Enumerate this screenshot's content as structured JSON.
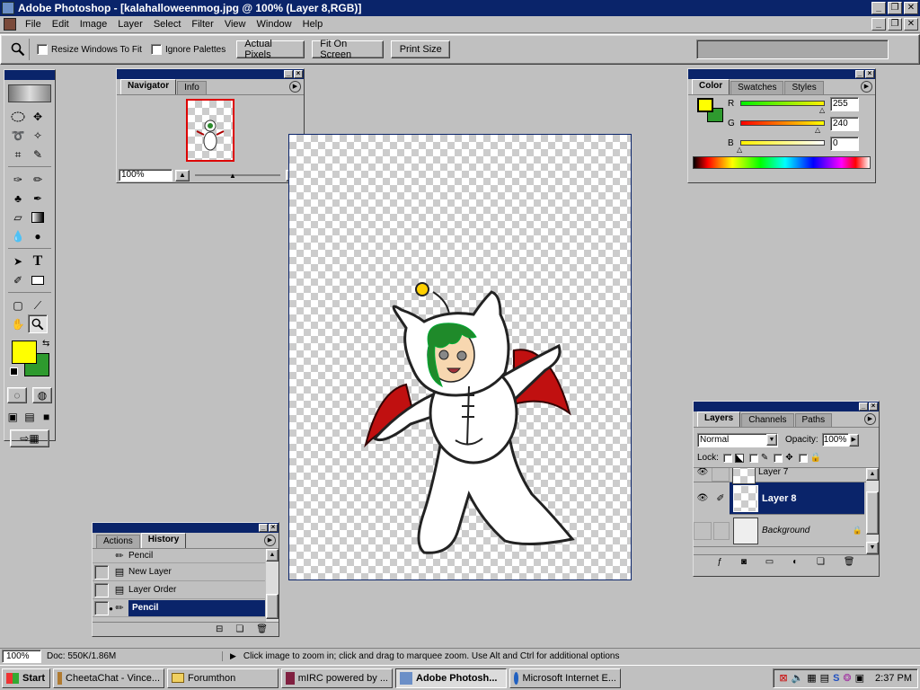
{
  "window": {
    "title": "Adobe Photoshop - [kalahalloweenmog.jpg @ 100% (Layer 8,RGB)]"
  },
  "menu": [
    "File",
    "Edit",
    "Image",
    "Layer",
    "Select",
    "Filter",
    "View",
    "Window",
    "Help"
  ],
  "options_bar": {
    "resize_windows": "Resize Windows To Fit",
    "ignore_palettes": "Ignore Palettes",
    "actual_pixels": "Actual Pixels",
    "fit_on_screen": "Fit On Screen",
    "print_size": "Print Size"
  },
  "navigator": {
    "tabs": [
      "Navigator",
      "Info"
    ],
    "zoom": "100%"
  },
  "color_palette": {
    "tabs": [
      "Color",
      "Swatches",
      "Styles"
    ],
    "r_label": "R",
    "g_label": "G",
    "b_label": "B",
    "r": "255",
    "g": "240",
    "b": "0"
  },
  "layers_palette": {
    "tabs": [
      "Layers",
      "Channels",
      "Paths"
    ],
    "blend_mode": "Normal",
    "opacity_label": "Opacity:",
    "opacity": "100%",
    "lock_label": "Lock:",
    "layers": [
      "Layer 7",
      "Layer 8",
      "Background"
    ]
  },
  "history_palette": {
    "tabs": [
      "Actions",
      "History"
    ],
    "items": [
      "Pencil",
      "New Layer",
      "Layer Order",
      "Pencil"
    ]
  },
  "status_bar": {
    "zoom": "100%",
    "doc": "Doc: 550K/1.86M",
    "hint": "Click image to zoom in; click and drag to marquee zoom.  Use Alt and Ctrl for additional options"
  },
  "taskbar": {
    "start": "Start",
    "tasks": [
      "CheetaChat - Vince...",
      "Forumthon",
      "mIRC powered by ...",
      "Adobe Photosh...",
      "Microsoft Internet E..."
    ],
    "clock": "2:37 PM"
  },
  "colors": {
    "foreground": "#ffff00",
    "background": "#2e9a2e",
    "titlebar": "#0a246a"
  }
}
